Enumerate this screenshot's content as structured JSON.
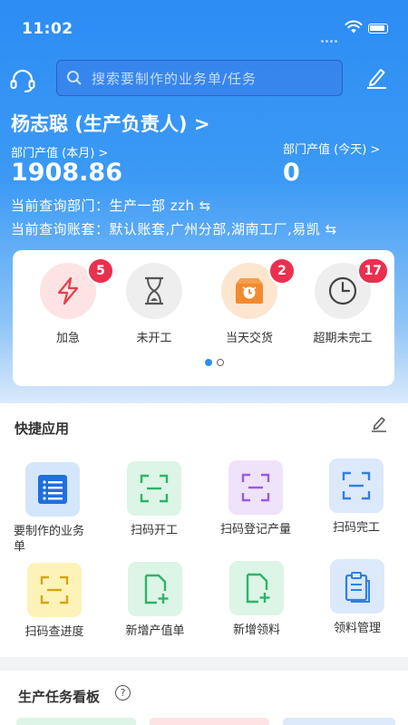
{
  "status": {
    "time": "11:02"
  },
  "search": {
    "placeholder": "搜索要制作的业务单/任务"
  },
  "user": {
    "name": "杨志聪 (生产负责人) >"
  },
  "output": {
    "month_label": "部门产值 (本月) >",
    "month_value": "1908.86",
    "today_label": "部门产值 (今天) >",
    "today_value": "0"
  },
  "query": {
    "dept": "当前查询部门：生产一部 zzh ⇆",
    "books": "当前查询账套：默认账套,广州分部,湖南工厂,易凯 ⇆"
  },
  "stats": [
    {
      "label": "加急",
      "badge": "5",
      "icon": "lightning-icon"
    },
    {
      "label": "未开工",
      "badge": "",
      "icon": "hourglass-icon"
    },
    {
      "label": "当天交货",
      "badge": "2",
      "icon": "alarm-box-icon"
    },
    {
      "label": "超期未完工",
      "badge": "17",
      "icon": "clock-icon"
    }
  ],
  "quick": {
    "title": "快捷应用",
    "apps": [
      {
        "label": "要制作的业务单",
        "icon": "list-icon"
      },
      {
        "label": "扫码开工",
        "icon": "scan-icon"
      },
      {
        "label": "扫码登记产量",
        "icon": "scan-icon"
      },
      {
        "label": "扫码完工",
        "icon": "scan-icon"
      },
      {
        "label": "扫码查进度",
        "icon": "scan-icon"
      },
      {
        "label": "新增产值单",
        "icon": "add-doc-icon"
      },
      {
        "label": "新增领料",
        "icon": "add-doc-icon"
      },
      {
        "label": "领料管理",
        "icon": "clipboard-icon"
      }
    ]
  },
  "board": {
    "title": "生产任务看板",
    "help": "?"
  },
  "colors": {
    "primary": "#2f8cf3",
    "badge": "#e9304f",
    "scan_green": "#2fb36a",
    "scan_purple": "#9a5be0",
    "scan_yellow": "#d4a514"
  }
}
